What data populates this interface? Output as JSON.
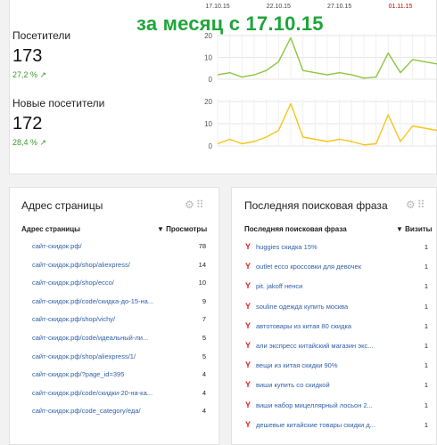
{
  "overlay_title": "за месяц с 17.10.15",
  "summary": {
    "metrics": [
      {
        "label": "Посетители",
        "value": "173",
        "delta": "27,2 % ↗"
      },
      {
        "label": "Новые посетители",
        "value": "172",
        "delta": "28,4 % ↗"
      }
    ]
  },
  "chart_data": [
    {
      "type": "line",
      "x": [
        "17.10.15",
        "18.10.15",
        "19.10.15",
        "20.10.15",
        "21.10.15",
        "22.10.15",
        "23.10.15",
        "24.10.15",
        "25.10.15",
        "26.10.15",
        "27.10.15",
        "28.10.15",
        "29.10.15",
        "30.10.15",
        "31.10.15",
        "01.11.15",
        "02.11.15",
        "03.11.15",
        "04.11.15"
      ],
      "x_tick_labels": [
        "17.10.15",
        "22.10.15",
        "27.10.15",
        "01.11.15"
      ],
      "series": [
        {
          "color": "#8cc63f",
          "values": [
            2,
            3,
            1,
            2,
            4,
            8,
            19,
            4,
            3,
            2,
            3,
            2,
            0.5,
            1,
            12,
            3,
            9,
            8,
            7
          ]
        }
      ],
      "yticks": [
        0,
        10,
        20
      ],
      "ylim": [
        0,
        20
      ]
    },
    {
      "type": "line",
      "x": [
        "17.10.15",
        "18.10.15",
        "19.10.15",
        "20.10.15",
        "21.10.15",
        "22.10.15",
        "23.10.15",
        "24.10.15",
        "25.10.15",
        "26.10.15",
        "27.10.15",
        "28.10.15",
        "29.10.15",
        "30.10.15",
        "31.10.15",
        "01.11.15",
        "02.11.15",
        "03.11.15",
        "04.11.15"
      ],
      "series": [
        {
          "color": "#f5c518",
          "values": [
            1,
            3,
            1,
            2,
            4,
            7,
            19,
            4,
            3,
            2,
            3,
            2,
            0.5,
            1,
            14,
            2,
            9,
            8,
            7
          ]
        }
      ],
      "yticks": [
        0,
        10,
        20
      ],
      "ylim": [
        0,
        20
      ]
    }
  ],
  "pages_panel": {
    "title": "Адрес страницы",
    "col_url": "Адрес страницы",
    "col_views": "▼ Просмотры",
    "rows": [
      {
        "url": "сайт-скидок.рф/",
        "views": "78"
      },
      {
        "url": "сайт-скидок.рф/shop/aliexpress/",
        "views": "14"
      },
      {
        "url": "сайт-скидок.рф/shop/ecco/",
        "views": "10"
      },
      {
        "url": "сайт-скидок.рф/code/скидка-до-15-на...",
        "views": "9"
      },
      {
        "url": "сайт-скидок.рф/shop/vichy/",
        "views": "7"
      },
      {
        "url": "сайт-скидок.рф/code/идеальный-ли...",
        "views": "5"
      },
      {
        "url": "сайт-скидок.рф/shop/aliexpress/1/",
        "views": "5"
      },
      {
        "url": "сайт-скидок.рф/?page_id=395",
        "views": "4"
      },
      {
        "url": "сайт-скидок.рф/code/скидки-20-на-ка...",
        "views": "4"
      },
      {
        "url": "сайт-скидок.рф/code_category/еда/",
        "views": "4"
      }
    ]
  },
  "phrases_panel": {
    "title": "Последняя поисковая фраза",
    "col_phrase": "Последняя поисковая фраза",
    "col_visits": "▼ Визиты",
    "engine_glyph": "Y",
    "rows": [
      {
        "phrase": "huggies скидка 15%",
        "visits": "1"
      },
      {
        "phrase": "outlet ecco кроссовки для девочек",
        "visits": "1"
      },
      {
        "phrase": "pit. jakoff ненси",
        "visits": "1"
      },
      {
        "phrase": "souline одежда купить москва",
        "visits": "1"
      },
      {
        "phrase": "автотовары из китая 80 скидка",
        "visits": "1"
      },
      {
        "phrase": "али экспресс китайский магазин экс...",
        "visits": "1"
      },
      {
        "phrase": "вещи из китая скидки 90%",
        "visits": "1"
      },
      {
        "phrase": "виши купить со скидкой",
        "visits": "1"
      },
      {
        "phrase": "виши набор мицеллярный лосьон 2...",
        "visits": "1"
      },
      {
        "phrase": "дешевые китайские товары скидки д...",
        "visits": "1"
      }
    ]
  },
  "icons": {
    "settings": "gear-icon",
    "drag": "drag-handle-icon"
  }
}
